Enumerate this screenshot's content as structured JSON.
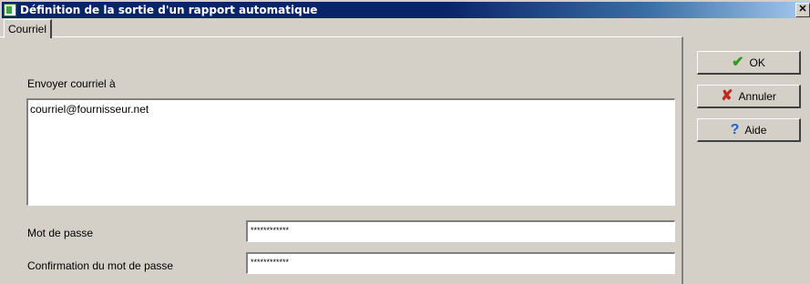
{
  "window": {
    "title": "Définition de la sortie d'un rapport automatique",
    "close_glyph": "✕"
  },
  "tabs": [
    {
      "label": "Courriel"
    }
  ],
  "form": {
    "email_label": "Envoyer courriel à",
    "email_value": "courriel@fournisseur.net",
    "password_label": "Mot de passe",
    "password_value": "************",
    "confirm_label": "Confirmation du mot de passe",
    "confirm_value": "************"
  },
  "buttons": {
    "ok": {
      "label": "OK",
      "icon": "checkmark-icon",
      "glyph": "✔",
      "color": "#2e9a1e"
    },
    "cancel": {
      "label": "Annuler",
      "icon": "x-icon",
      "glyph": "✘",
      "color": "#c0281c"
    },
    "help": {
      "label": "Aide",
      "icon": "question-icon",
      "glyph": "?",
      "color": "#1e64c8"
    }
  }
}
